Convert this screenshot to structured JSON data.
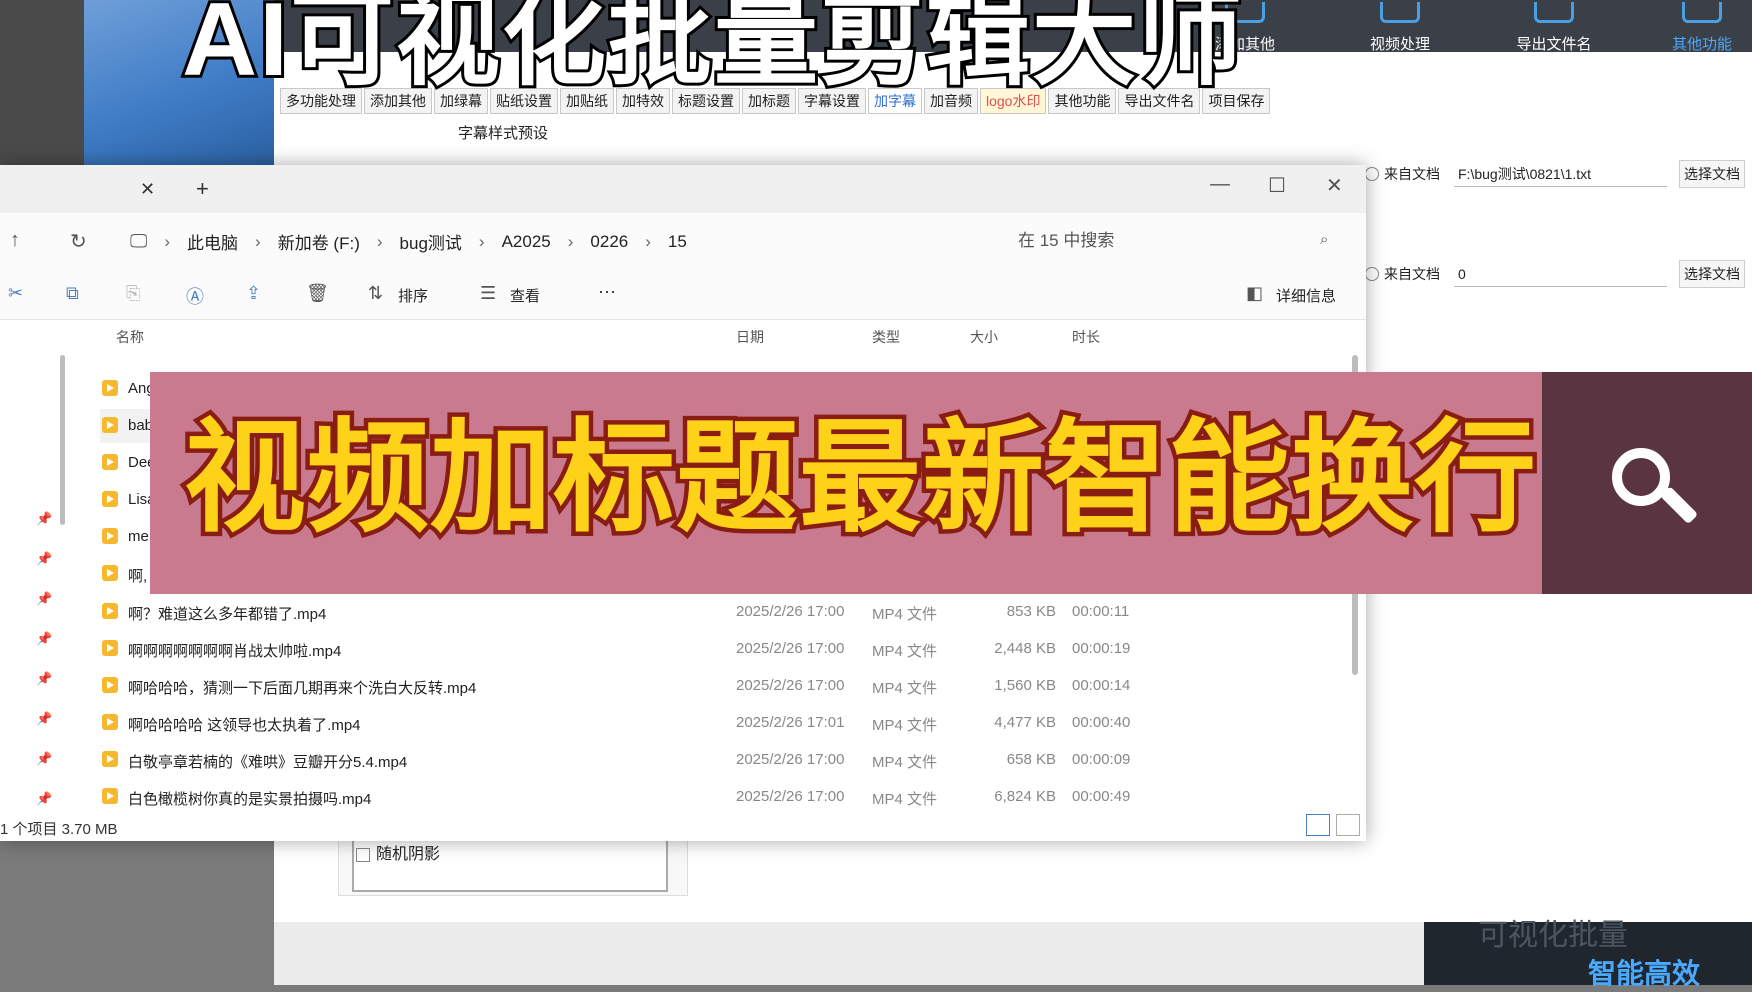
{
  "overlay": {
    "top_title": "AI可视化批量剪辑大师",
    "ribbon_text": "视频加标题最新智能换行"
  },
  "app": {
    "toolbar": [
      {
        "label": "添加其他",
        "icon": "add-icon"
      },
      {
        "label": "视频处理",
        "icon": "filter-icon"
      },
      {
        "label": "导出文件名",
        "icon": "export-icon"
      },
      {
        "label": "其他功能",
        "icon": "grid-icon"
      }
    ],
    "tabs": [
      "多功能处理",
      "添加其他",
      "加绿幕",
      "贴纸设置",
      "加贴纸",
      "加特效",
      "标题设置",
      "加标题",
      "字幕设置",
      "加字幕",
      "加音频",
      "logo水印",
      "其他功能",
      "导出文件名",
      "项目保存"
    ],
    "active_tab": "加字幕",
    "preset_label": "字幕样式预设",
    "right_rows": [
      {
        "radio_label": "来自文档",
        "value": "F:\\bug测试\\0821\\1.txt",
        "button": "选择文档"
      },
      {
        "radio_label": "来自文档",
        "value": "0",
        "button": "选择文档"
      }
    ],
    "random_shadow_label": "随机阴影",
    "bottom_promo_ghost": "可视化批量",
    "bottom_promo": "智能高效"
  },
  "explorer": {
    "breadcrumbs": [
      "此电脑",
      "新加卷 (F:)",
      "bug测试",
      "A2025",
      "0226",
      "15"
    ],
    "search_placeholder": "在 15 中搜索",
    "commands": {
      "sort": "排序",
      "view": "查看",
      "more": "···",
      "details": "详细信息"
    },
    "columns": {
      "name": "名称",
      "date": "日期",
      "type": "类型",
      "size": "大小",
      "duration": "时长"
    },
    "partial_files": [
      "Ang",
      "bab",
      "Dee",
      "Lisa",
      "me",
      "啊,"
    ],
    "files": [
      {
        "name": "啊？难道这么多年都错了.mp4",
        "date": "2025/2/26 17:00",
        "type": "MP4 文件",
        "size": "853 KB",
        "duration": "00:00:11"
      },
      {
        "name": "啊啊啊啊啊啊啊肖战太帅啦.mp4",
        "date": "2025/2/26 17:00",
        "type": "MP4 文件",
        "size": "2,448 KB",
        "duration": "00:00:19"
      },
      {
        "name": "啊哈哈哈，猜测一下后面几期再来个洗白大反转.mp4",
        "date": "2025/2/26 17:00",
        "type": "MP4 文件",
        "size": "1,560 KB",
        "duration": "00:00:14"
      },
      {
        "name": "啊哈哈哈哈 这领导也太执着了.mp4",
        "date": "2025/2/26 17:01",
        "type": "MP4 文件",
        "size": "4,477 KB",
        "duration": "00:00:40"
      },
      {
        "name": "白敬亭章若楠的《难哄》豆瓣开分5.4.mp4",
        "date": "2025/2/26 17:00",
        "type": "MP4 文件",
        "size": "658 KB",
        "duration": "00:00:09"
      },
      {
        "name": "白色橄榄树你真的是实景拍摄吗.mp4",
        "date": "2025/2/26 17:00",
        "type": "MP4 文件",
        "size": "6,824 KB",
        "duration": "00:00:49"
      }
    ],
    "status": "1 个项目  3.70 MB"
  }
}
